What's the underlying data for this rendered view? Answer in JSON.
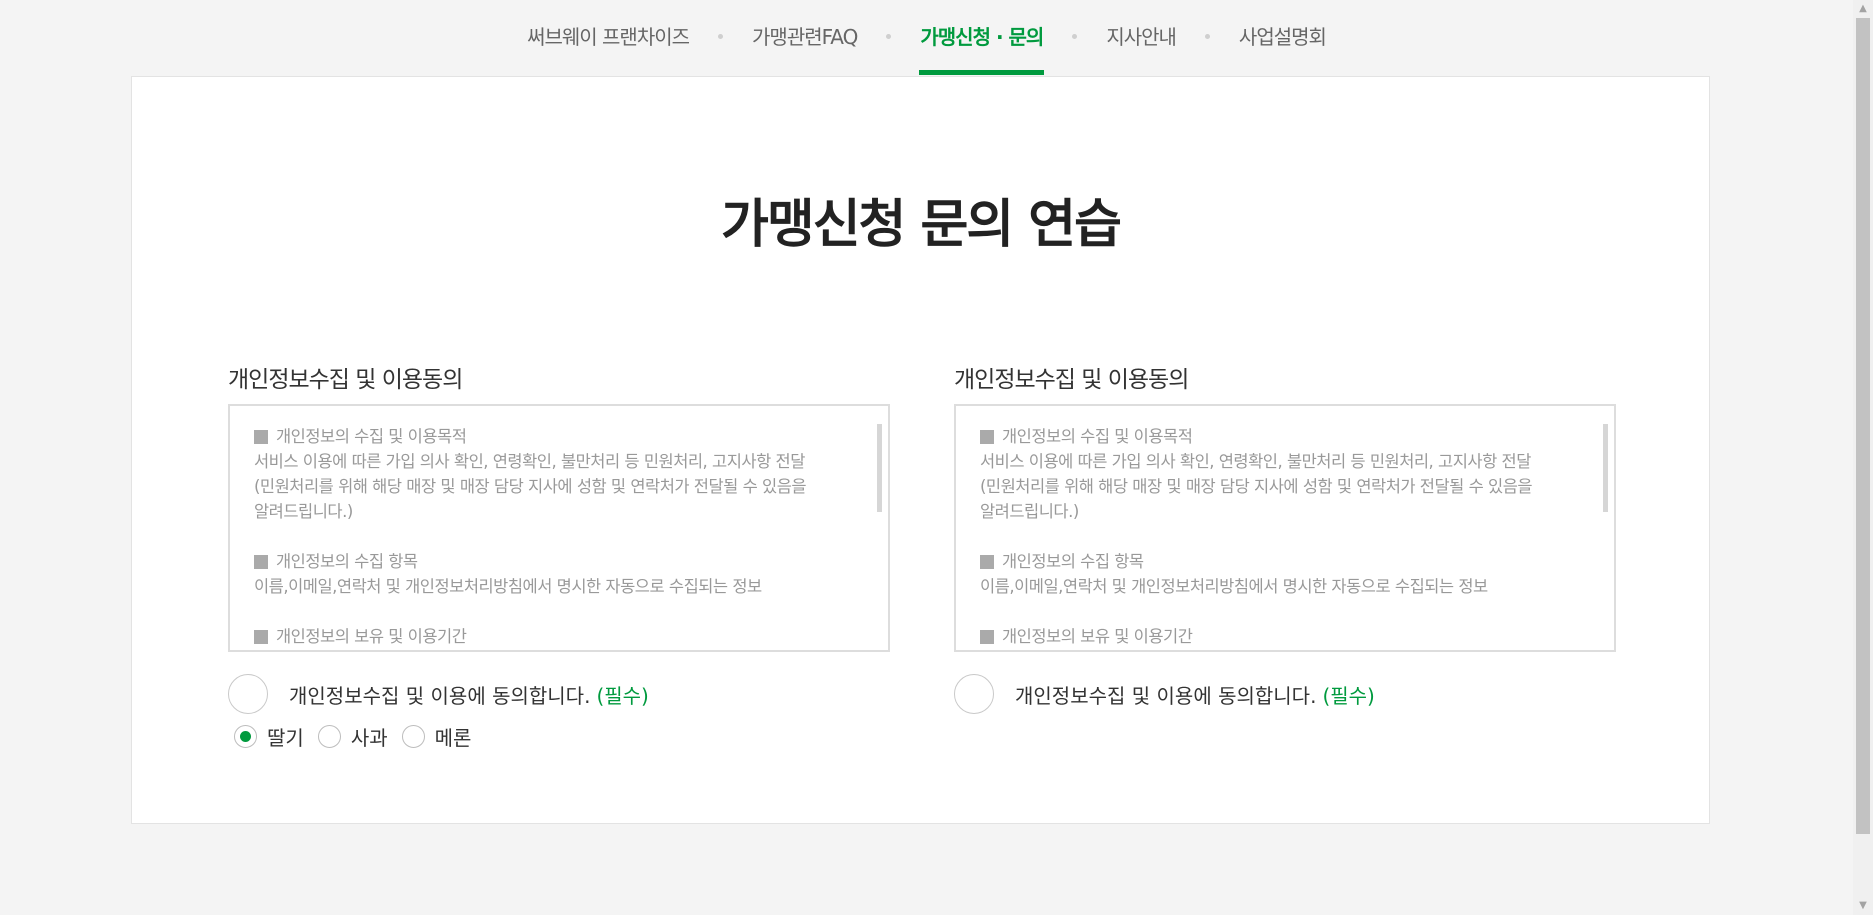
{
  "nav": {
    "items": [
      {
        "label": "써브웨이 프랜차이즈"
      },
      {
        "label": "가맹관련FAQ"
      },
      {
        "label": "가맹신청 · 문의"
      },
      {
        "label": "지사안내"
      },
      {
        "label": "사업설명회"
      }
    ],
    "active_index": 2
  },
  "main": {
    "title": "가맹신청 문의 연습",
    "columns": [
      {
        "section_title": "개인정보수집 및 이용동의",
        "terms": {
          "block1_head": "개인정보의 수집 및 이용목적",
          "block1_line1": "서비스 이용에 따른 가입 의사 확인, 연령확인, 불만처리 등 민원처리, 고지사항 전달",
          "block1_line2": "(민원처리를 위해 해당 매장 및 매장 담당 지사에 성함 및 연락처가 전달될 수 있음을",
          "block1_line3": "알려드립니다.)",
          "block2_head": "개인정보의 수집 항목",
          "block2_line1": "이름,이메일,연락처 및 개인정보처리방침에서 명시한 자동으로 수집되는 정보",
          "block3_head": "개인정보의 보유 및 이용기간"
        },
        "agree_label": "개인정보수집 및 이용에 동의합니다.",
        "agree_required": "(필수)",
        "radios": [
          {
            "label": "딸기",
            "checked": true
          },
          {
            "label": "사과",
            "checked": false
          },
          {
            "label": "메론",
            "checked": false
          }
        ]
      },
      {
        "section_title": "개인정보수집 및 이용동의",
        "terms": {
          "block1_head": "개인정보의 수집 및 이용목적",
          "block1_line1": "서비스 이용에 따른 가입 의사 확인, 연령확인, 불만처리 등 민원처리, 고지사항 전달",
          "block1_line2": "(민원처리를 위해 해당 매장 및 매장 담당 지사에 성함 및 연락처가 전달될 수 있음을",
          "block1_line3": "알려드립니다.)",
          "block2_head": "개인정보의 수집 항목",
          "block2_line1": "이름,이메일,연락처 및 개인정보처리방침에서 명시한 자동으로 수집되는 정보",
          "block3_head": "개인정보의 보유 및 이용기간"
        },
        "agree_label": "개인정보수집 및 이용에 동의합니다.",
        "agree_required": "(필수)"
      }
    ]
  },
  "colors": {
    "accent": "#009a3e",
    "text": "#333333",
    "muted": "#999999",
    "background": "#f4f4f4"
  }
}
